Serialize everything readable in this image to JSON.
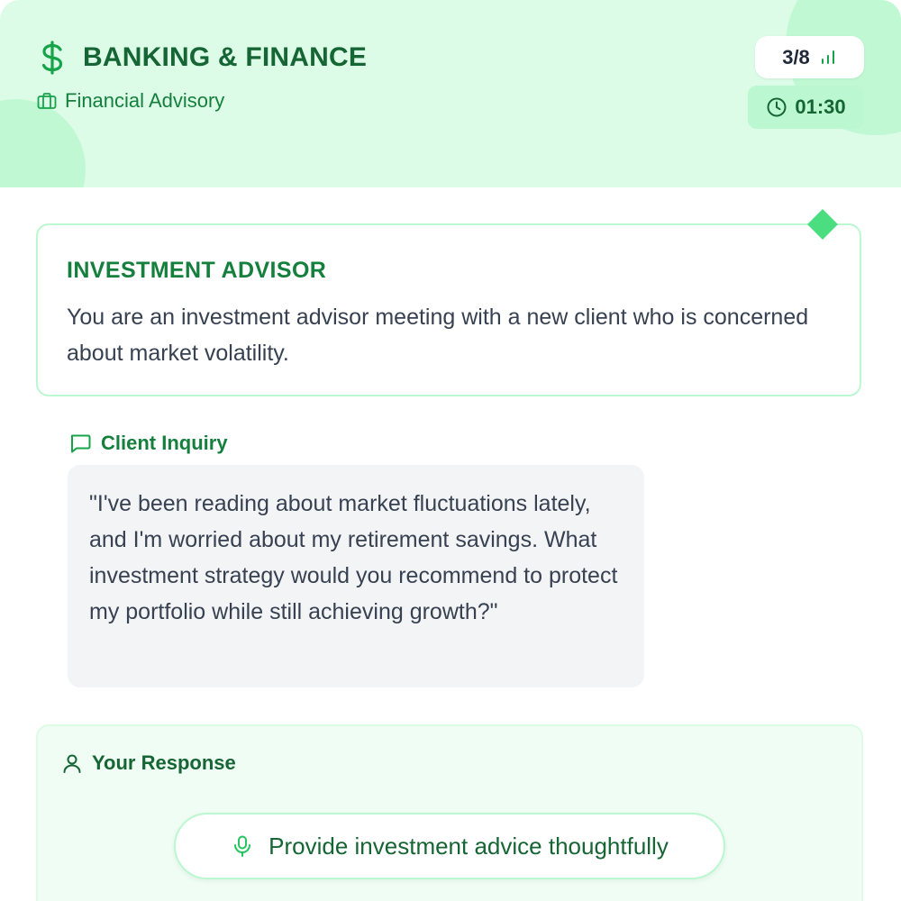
{
  "header": {
    "category": "BANKING & FINANCE",
    "subcategory": "Financial Advisory",
    "progress": "3/8",
    "timer": "01:30",
    "icons": {
      "category": "dollar-icon",
      "subcategory": "briefcase-icon",
      "progress": "signal-bars-icon",
      "timer": "clock-icon"
    }
  },
  "scenario": {
    "title": "INVESTMENT ADVISOR",
    "description": "You are an investment advisor meeting with a new client who is concerned about market volatility."
  },
  "inquiry": {
    "label": "Client Inquiry",
    "icon": "chat-bubble-icon",
    "text": "\"I've been reading about market fluctuations lately, and I'm worried about my retirement savings. What investment strategy would you recommend to protect my portfolio while still achieving growth?\""
  },
  "response": {
    "label": "Your Response",
    "icon": "user-icon",
    "button_label": "Provide investment advice thoughtfully",
    "button_icon": "microphone-icon"
  },
  "colors": {
    "accent": "#16a34a",
    "dark_green": "#166534",
    "header_bg": "#dcfce7",
    "diamond": "#4ade80"
  }
}
